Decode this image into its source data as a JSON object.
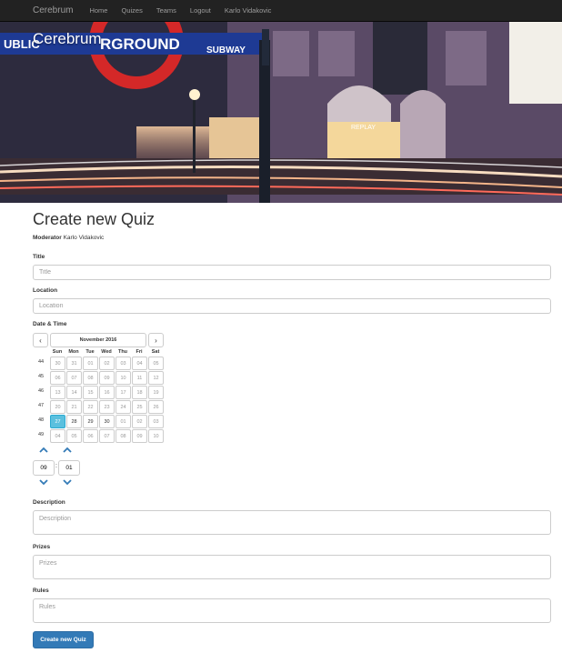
{
  "nav": {
    "brand": "Cerebrum",
    "items": [
      "Home",
      "Quizes",
      "Teams",
      "Logout",
      "Karlo Vidakovic"
    ]
  },
  "hero": {
    "title": "Cerebrum",
    "sign_word": "RGROUND",
    "sign_left": "UBLIC",
    "sign_subway": "SUBWAY",
    "shop": "REPLAY"
  },
  "page": {
    "title": "Create new Quiz",
    "moderator_label": "Moderator",
    "moderator_name": "Karlo Vidakovic"
  },
  "form": {
    "title_label": "Title",
    "title_placeholder": "Title",
    "location_label": "Location",
    "location_placeholder": "Location",
    "datetime_label": "Date & Time",
    "description_label": "Description",
    "description_placeholder": "Description",
    "prizes_label": "Prizes",
    "prizes_placeholder": "Prizes",
    "rules_label": "Rules",
    "rules_placeholder": "Rules",
    "submit_label": "Create new Quiz"
  },
  "calendar": {
    "month": "November 2016",
    "prev_glyph": "‹",
    "next_glyph": "›",
    "weekdays": [
      "Sun",
      "Mon",
      "Tue",
      "Wed",
      "Thu",
      "Fri",
      "Sat"
    ],
    "weeks": [
      {
        "week": "44",
        "days": [
          "30",
          "31",
          "01",
          "02",
          "03",
          "04",
          "05"
        ]
      },
      {
        "week": "45",
        "days": [
          "06",
          "07",
          "08",
          "09",
          "10",
          "11",
          "12"
        ]
      },
      {
        "week": "46",
        "days": [
          "13",
          "14",
          "15",
          "16",
          "17",
          "18",
          "19"
        ]
      },
      {
        "week": "47",
        "days": [
          "20",
          "21",
          "22",
          "23",
          "24",
          "25",
          "26"
        ]
      },
      {
        "week": "48",
        "days": [
          "27",
          "28",
          "29",
          "30",
          "01",
          "02",
          "03"
        ]
      },
      {
        "week": "49",
        "days": [
          "04",
          "05",
          "06",
          "07",
          "08",
          "09",
          "10"
        ]
      }
    ],
    "selected": "27"
  },
  "time": {
    "hour": "09",
    "minute": "01",
    "separator": ":"
  },
  "colors": {
    "primary": "#337ab7",
    "selected_day": "#5bc0de",
    "navbar": "#222222"
  }
}
